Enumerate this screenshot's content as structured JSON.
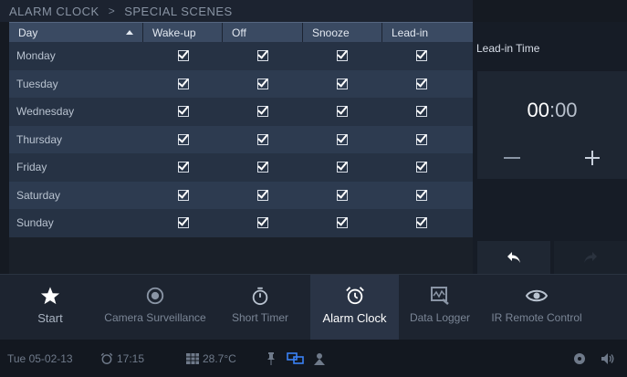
{
  "breadcrumb": {
    "root": "ALARM CLOCK",
    "separator": ">",
    "current": "SPECIAL SCENES"
  },
  "table": {
    "headers": {
      "day": "Day",
      "wakeup": "Wake-up",
      "off": "Off",
      "snooze": "Snooze",
      "leadin": "Lead-in"
    },
    "rows": [
      {
        "day": "Monday"
      },
      {
        "day": "Tuesday"
      },
      {
        "day": "Wednesday"
      },
      {
        "day": "Thursday"
      },
      {
        "day": "Friday"
      },
      {
        "day": "Saturday"
      },
      {
        "day": "Sunday"
      }
    ]
  },
  "side": {
    "title": "Lead-in Time",
    "hours": "00",
    "colon": ":",
    "minutes": "00"
  },
  "nav": {
    "start": "Start",
    "camera": "Camera Surveillance",
    "short_timer": "Short Timer",
    "alarm_clock": "Alarm Clock",
    "data_logger": "Data Logger",
    "ir_remote": "IR Remote Control"
  },
  "status": {
    "date": "Tue 05-02-13",
    "time": "17:15",
    "temperature": "28.7°C"
  },
  "colors": {
    "accent_blue": "#3b82f6",
    "header_blue": "#3a4a62"
  }
}
